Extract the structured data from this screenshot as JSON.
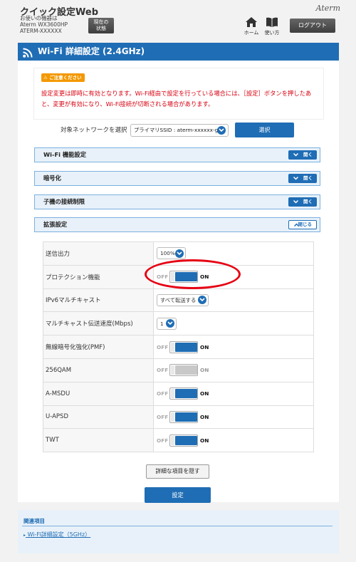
{
  "header": {
    "app_title": "クイック設定Web",
    "device_caption": "お使いの機器は",
    "device_model": "Aterm WX3600HP",
    "device_ssid": "ATERM-XXXXXX",
    "status_button_line1": "現在の",
    "status_button_line2": "状態",
    "brand": "Aterm",
    "home_label": "ホーム",
    "help_label": "使い方",
    "logout_label": "ログアウト"
  },
  "page_title": "Wi-Fi 詳細設定 (2.4GHz)",
  "notice": {
    "badge": "ご注意ください",
    "text": "設定変更は即時に有効となります。Wi-Fi経由で設定を行っている場合には、［設定］ボタンを押したあと、変更が有効になり、Wi-Fi接続が切断される場合があります。"
  },
  "network_select": {
    "label": "対象ネットワークを選択",
    "value": "プライマリSSID : aterm-xxxxxx-g",
    "button": "選択"
  },
  "sections": [
    {
      "title": "Wi-Fi 機能設定",
      "button": "開く"
    },
    {
      "title": "暗号化",
      "button": "開く"
    },
    {
      "title": "子機の接続制限",
      "button": "開く"
    },
    {
      "title": "拡張設定",
      "button": "閉じる"
    }
  ],
  "toggle_labels": {
    "off": "OFF",
    "on": "ON"
  },
  "settings": {
    "tx_power": {
      "label": "送信出力",
      "value": "100%"
    },
    "protection": {
      "label": "プロテクション機能",
      "state": true
    },
    "ipv6_multicast": {
      "label": "IPv6マルチキャスト",
      "value": "すべて転送する"
    },
    "multicast_rate": {
      "label": "マルチキャスト伝送速度(Mbps)",
      "value": "1"
    },
    "pmf": {
      "label": "無線暗号化強化(PMF)",
      "state": true
    },
    "qam256": {
      "label": "256QAM",
      "state": true,
      "disabled": true
    },
    "amsdu": {
      "label": "A-MSDU",
      "state": true
    },
    "uapsd": {
      "label": "U-APSD",
      "state": true
    },
    "twt": {
      "label": "TWT",
      "state": true
    }
  },
  "buttons": {
    "hide_details": "詳細な項目を隠す",
    "apply": "設定"
  },
  "related": {
    "title": "関連項目",
    "link": "Wi-Fi詳細設定（5GHz）"
  },
  "colors": {
    "primary": "#1f6db5",
    "highlight": "#e60012",
    "notice_text": "#d7000f",
    "badge": "#f39800"
  }
}
